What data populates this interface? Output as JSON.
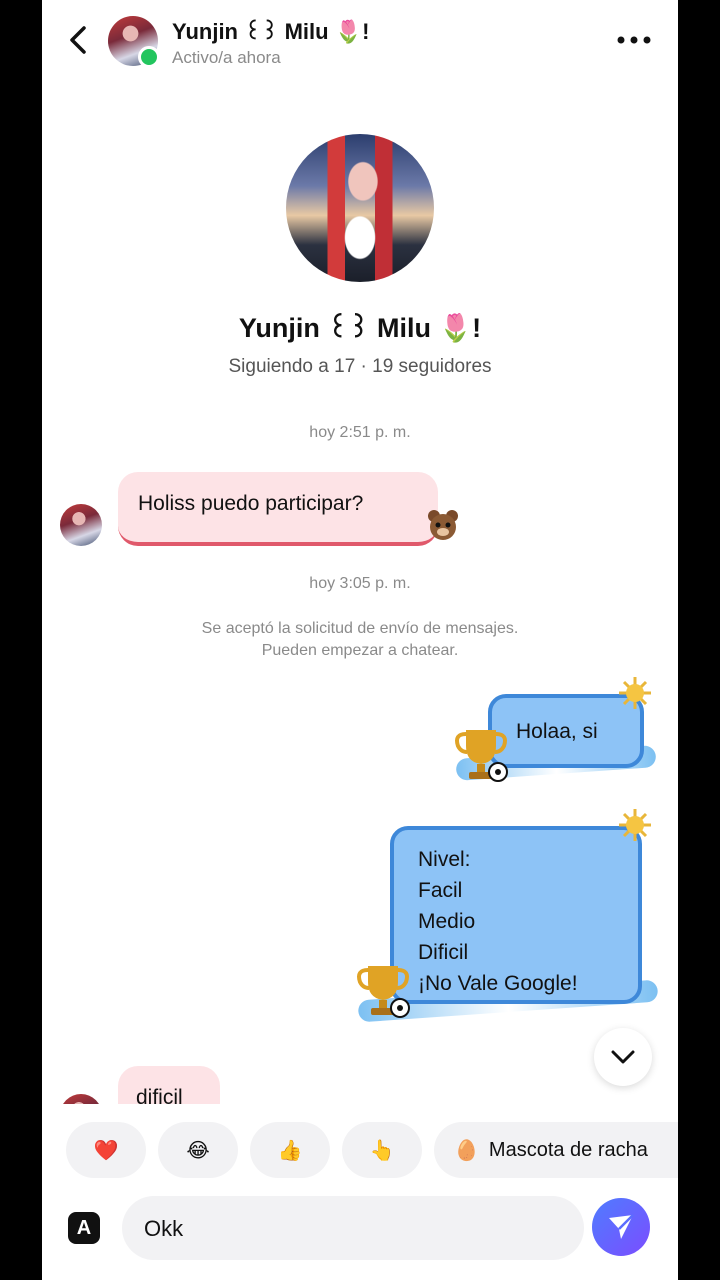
{
  "header": {
    "name": "Yunjin ꒰꒱ Milu 🌷!",
    "status": "Activo/a ahora"
  },
  "profile": {
    "name": "Yunjin ꒰꒱ Milu 🌷!",
    "stats": "Siguiendo a 17 · 19 seguidores"
  },
  "chat": {
    "timestamp_1": "hoy 2:51 p. m.",
    "message_1": "Holiss puedo participar?",
    "timestamp_2": "hoy 3:05 p. m.",
    "system_line_1": "Se aceptó la solicitud de envío de mensajes.",
    "system_line_2": "Pueden empezar a chatear.",
    "reply_1": "Holaa, si",
    "reply_2_lines": [
      "Nivel:",
      "Facil",
      "Medio",
      "Dificil",
      "¡No Vale Google!"
    ],
    "message_2": "dificil"
  },
  "quick_reactions": [
    {
      "emoji": "❤️"
    },
    {
      "emoji": "😂"
    },
    {
      "emoji": "👍"
    },
    {
      "emoji": "👆"
    },
    {
      "emoji": "🥚",
      "label": "Mascota de racha"
    }
  ],
  "composer": {
    "value": "Okk",
    "a_label": "A"
  },
  "colors": {
    "incoming_bubble": "#fde3e6",
    "outgoing_bubble": "#8dc3f6",
    "send_button": "#5b6cff",
    "online": "#22c55e"
  }
}
